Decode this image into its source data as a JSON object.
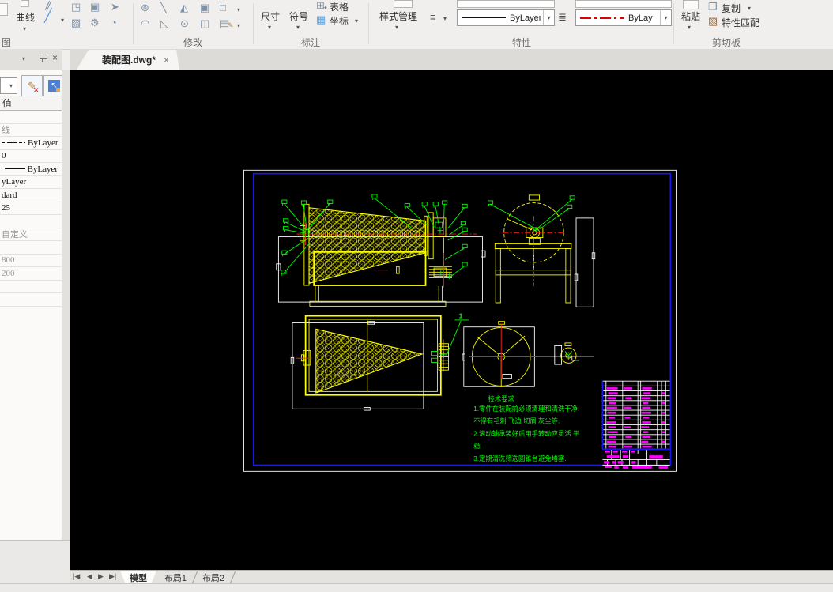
{
  "colors": {
    "cad-yellow": "#ffff00",
    "cad-green": "#00ff00",
    "cad-red": "#ff2020",
    "cad-white": "#ffffff",
    "cad-magenta": "#ff00ff",
    "frame-blue": "#1616e8"
  },
  "ribbon": {
    "panels": [
      {
        "label": "图"
      },
      {
        "label": "修改"
      },
      {
        "label": "标注"
      },
      {
        "label": "特性"
      },
      {
        "label": "剪切板"
      }
    ],
    "draw": {
      "curve": "曲线"
    },
    "annotate": {
      "dimension": "尺寸",
      "symbol": "符号",
      "table": "表格",
      "coordinate": "坐标"
    },
    "properties": {
      "style_manager": "样式管理",
      "linetype_value": "ByLayer",
      "linetype2_value": "ByLay"
    },
    "clipboard": {
      "paste": "粘贴",
      "copy": "复制",
      "match": "特性匹配"
    }
  },
  "document_tab": {
    "title": "装配图.dwg*",
    "close": "×"
  },
  "side_panel": {
    "header_value": "值",
    "rows": [
      {
        "type": "blank"
      },
      {
        "text": "线",
        "muted": true
      },
      {
        "type": "linetype",
        "style": "dashdot",
        "text": "ByLayer"
      },
      {
        "text": "0"
      },
      {
        "type": "linetype",
        "style": "solid",
        "text": "ByLayer",
        "align": "right"
      },
      {
        "text": "yLayer"
      },
      {
        "text": "dard"
      },
      {
        "text": "25"
      },
      {
        "type": "blank"
      },
      {
        "text": "自定义",
        "muted": true
      },
      {
        "type": "blank"
      },
      {
        "text": "800",
        "muted": true
      },
      {
        "text": "200",
        "muted": true
      },
      {
        "type": "blank"
      },
      {
        "type": "blank"
      }
    ]
  },
  "drawing": {
    "tech_requirements": {
      "title": "技术要求",
      "lines": [
        "1.零件在装配前必须清理和清洗干净.",
        "不得有毛刺 飞边 切屑 灰尘等.",
        "2.滚动轴承装好后用手转动应灵活 平",
        "稳.",
        "3.定期清洗筛选圆锥台避免堵塞."
      ]
    },
    "section_label": "1"
  },
  "bottom_bar": {
    "nav": [
      "|◀",
      "◀",
      "▶",
      "▶|"
    ],
    "tabs": [
      {
        "label": "模型",
        "active": true
      },
      {
        "label": "布局1",
        "active": false
      },
      {
        "label": "布局2",
        "active": false
      }
    ]
  }
}
